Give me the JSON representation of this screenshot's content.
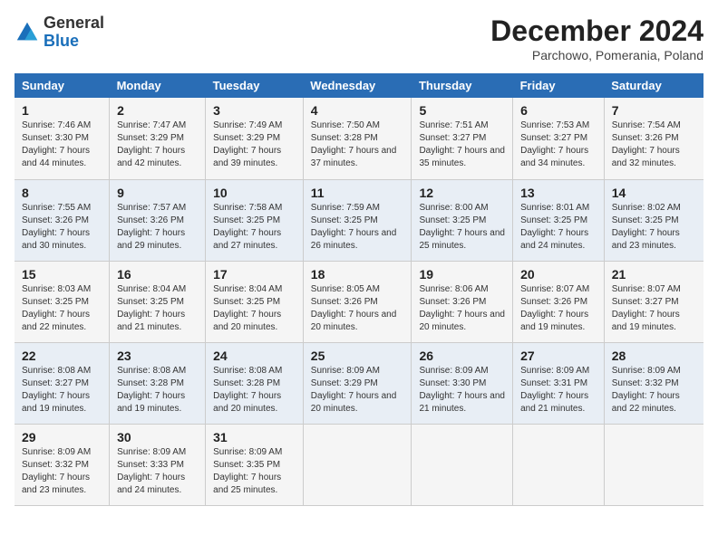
{
  "logo": {
    "text_general": "General",
    "text_blue": "Blue"
  },
  "title": "December 2024",
  "subtitle": "Parchowo, Pomerania, Poland",
  "days_of_week": [
    "Sunday",
    "Monday",
    "Tuesday",
    "Wednesday",
    "Thursday",
    "Friday",
    "Saturday"
  ],
  "weeks": [
    [
      {
        "day": "1",
        "sunrise": "7:46 AM",
        "sunset": "3:30 PM",
        "daylight": "7 hours and 44 minutes."
      },
      {
        "day": "2",
        "sunrise": "7:47 AM",
        "sunset": "3:29 PM",
        "daylight": "7 hours and 42 minutes."
      },
      {
        "day": "3",
        "sunrise": "7:49 AM",
        "sunset": "3:29 PM",
        "daylight": "7 hours and 39 minutes."
      },
      {
        "day": "4",
        "sunrise": "7:50 AM",
        "sunset": "3:28 PM",
        "daylight": "7 hours and 37 minutes."
      },
      {
        "day": "5",
        "sunrise": "7:51 AM",
        "sunset": "3:27 PM",
        "daylight": "7 hours and 35 minutes."
      },
      {
        "day": "6",
        "sunrise": "7:53 AM",
        "sunset": "3:27 PM",
        "daylight": "7 hours and 34 minutes."
      },
      {
        "day": "7",
        "sunrise": "7:54 AM",
        "sunset": "3:26 PM",
        "daylight": "7 hours and 32 minutes."
      }
    ],
    [
      {
        "day": "8",
        "sunrise": "7:55 AM",
        "sunset": "3:26 PM",
        "daylight": "7 hours and 30 minutes."
      },
      {
        "day": "9",
        "sunrise": "7:57 AM",
        "sunset": "3:26 PM",
        "daylight": "7 hours and 29 minutes."
      },
      {
        "day": "10",
        "sunrise": "7:58 AM",
        "sunset": "3:25 PM",
        "daylight": "7 hours and 27 minutes."
      },
      {
        "day": "11",
        "sunrise": "7:59 AM",
        "sunset": "3:25 PM",
        "daylight": "7 hours and 26 minutes."
      },
      {
        "day": "12",
        "sunrise": "8:00 AM",
        "sunset": "3:25 PM",
        "daylight": "7 hours and 25 minutes."
      },
      {
        "day": "13",
        "sunrise": "8:01 AM",
        "sunset": "3:25 PM",
        "daylight": "7 hours and 24 minutes."
      },
      {
        "day": "14",
        "sunrise": "8:02 AM",
        "sunset": "3:25 PM",
        "daylight": "7 hours and 23 minutes."
      }
    ],
    [
      {
        "day": "15",
        "sunrise": "8:03 AM",
        "sunset": "3:25 PM",
        "daylight": "7 hours and 22 minutes."
      },
      {
        "day": "16",
        "sunrise": "8:04 AM",
        "sunset": "3:25 PM",
        "daylight": "7 hours and 21 minutes."
      },
      {
        "day": "17",
        "sunrise": "8:04 AM",
        "sunset": "3:25 PM",
        "daylight": "7 hours and 20 minutes."
      },
      {
        "day": "18",
        "sunrise": "8:05 AM",
        "sunset": "3:26 PM",
        "daylight": "7 hours and 20 minutes."
      },
      {
        "day": "19",
        "sunrise": "8:06 AM",
        "sunset": "3:26 PM",
        "daylight": "7 hours and 20 minutes."
      },
      {
        "day": "20",
        "sunrise": "8:07 AM",
        "sunset": "3:26 PM",
        "daylight": "7 hours and 19 minutes."
      },
      {
        "day": "21",
        "sunrise": "8:07 AM",
        "sunset": "3:27 PM",
        "daylight": "7 hours and 19 minutes."
      }
    ],
    [
      {
        "day": "22",
        "sunrise": "8:08 AM",
        "sunset": "3:27 PM",
        "daylight": "7 hours and 19 minutes."
      },
      {
        "day": "23",
        "sunrise": "8:08 AM",
        "sunset": "3:28 PM",
        "daylight": "7 hours and 19 minutes."
      },
      {
        "day": "24",
        "sunrise": "8:08 AM",
        "sunset": "3:28 PM",
        "daylight": "7 hours and 20 minutes."
      },
      {
        "day": "25",
        "sunrise": "8:09 AM",
        "sunset": "3:29 PM",
        "daylight": "7 hours and 20 minutes."
      },
      {
        "day": "26",
        "sunrise": "8:09 AM",
        "sunset": "3:30 PM",
        "daylight": "7 hours and 21 minutes."
      },
      {
        "day": "27",
        "sunrise": "8:09 AM",
        "sunset": "3:31 PM",
        "daylight": "7 hours and 21 minutes."
      },
      {
        "day": "28",
        "sunrise": "8:09 AM",
        "sunset": "3:32 PM",
        "daylight": "7 hours and 22 minutes."
      }
    ],
    [
      {
        "day": "29",
        "sunrise": "8:09 AM",
        "sunset": "3:32 PM",
        "daylight": "7 hours and 23 minutes."
      },
      {
        "day": "30",
        "sunrise": "8:09 AM",
        "sunset": "3:33 PM",
        "daylight": "7 hours and 24 minutes."
      },
      {
        "day": "31",
        "sunrise": "8:09 AM",
        "sunset": "3:35 PM",
        "daylight": "7 hours and 25 minutes."
      },
      null,
      null,
      null,
      null
    ]
  ],
  "labels": {
    "sunrise": "Sunrise: ",
    "sunset": "Sunset: ",
    "daylight": "Daylight: "
  }
}
